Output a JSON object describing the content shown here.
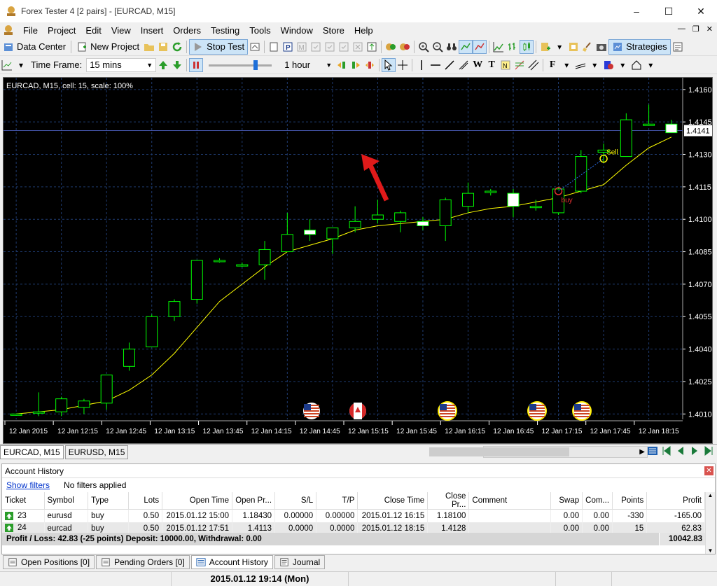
{
  "window": {
    "title": "Forex Tester 4  [2 pairs] - [EURCAD, M15]",
    "controls": [
      "–",
      "☐",
      "✕"
    ]
  },
  "menu": {
    "items": [
      "File",
      "Project",
      "Edit",
      "View",
      "Insert",
      "Orders",
      "Testing",
      "Tools",
      "Window",
      "Store",
      "Help"
    ]
  },
  "toolbar1": {
    "data_center": "Data Center",
    "new_project": "New Project",
    "stop_test": "Stop Test",
    "strategies": "Strategies"
  },
  "toolbar2": {
    "time_frame_label": "Time Frame:",
    "time_frame_value": "15 mins",
    "speed_value": "1 hour"
  },
  "chart": {
    "header": "EURCAD, M15, cell: 15, scale: 100%",
    "current_price": "1.4141",
    "colors": {
      "background": "#000000",
      "up": "#00ff00",
      "down_fill": "#ffffff",
      "ma": "#ffff00",
      "grid": "#1e3a6e"
    },
    "trade_labels": {
      "buy": "buy",
      "sell": "Sell"
    },
    "flags": [
      "us-flag",
      "us-flag",
      "canada-flag",
      "us-flag",
      "us-flag",
      "us-flag"
    ]
  },
  "chart_data": {
    "type": "candlestick",
    "y_ticks": [
      "1.4160",
      "1.4145",
      "1.4130",
      "1.4115",
      "1.4100",
      "1.4085",
      "1.4070",
      "1.4055",
      "1.4040",
      "1.4025",
      "1.4010"
    ],
    "x_ticks": [
      "12 Jan 2015",
      "12 Jan 12:15",
      "12 Jan 12:45",
      "12 Jan 13:15",
      "12 Jan 13:45",
      "12 Jan 14:15",
      "12 Jan 14:45",
      "12 Jan 15:15",
      "12 Jan 15:45",
      "12 Jan 16:15",
      "12 Jan 16:45",
      "12 Jan 17:15",
      "12 Jan 17:45",
      "12 Jan 18:15"
    ],
    "ylim": [
      1.4005,
      1.4165
    ],
    "candles": [
      {
        "o": 1.401,
        "h": 1.401,
        "l": 1.401,
        "c": 1.401
      },
      {
        "o": 1.4011,
        "h": 1.402,
        "l": 1.4009,
        "c": 1.4011
      },
      {
        "o": 1.4011,
        "h": 1.4018,
        "l": 1.4009,
        "c": 1.4017
      },
      {
        "o": 1.4013,
        "h": 1.4017,
        "l": 1.401,
        "c": 1.4016
      },
      {
        "o": 1.4015,
        "h": 1.4025,
        "l": 1.4012,
        "c": 1.4028
      },
      {
        "o": 1.4032,
        "h": 1.4043,
        "l": 1.403,
        "c": 1.404
      },
      {
        "o": 1.4041,
        "h": 1.4056,
        "l": 1.4041,
        "c": 1.4055
      },
      {
        "o": 1.4055,
        "h": 1.4063,
        "l": 1.4053,
        "c": 1.4062
      },
      {
        "o": 1.4063,
        "h": 1.4081,
        "l": 1.4061,
        "c": 1.4081
      },
      {
        "o": 1.4081,
        "h": 1.4082,
        "l": 1.408,
        "c": 1.4081
      },
      {
        "o": 1.4079,
        "h": 1.408,
        "l": 1.4078,
        "c": 1.4079
      },
      {
        "o": 1.4079,
        "h": 1.409,
        "l": 1.4072,
        "c": 1.4086
      },
      {
        "o": 1.4085,
        "h": 1.4103,
        "l": 1.4085,
        "c": 1.4093
      },
      {
        "o": 1.4095,
        "h": 1.41,
        "l": 1.409,
        "c": 1.4093
      },
      {
        "o": 1.4091,
        "h": 1.4096,
        "l": 1.4084,
        "c": 1.4096
      },
      {
        "o": 1.4096,
        "h": 1.4106,
        "l": 1.4094,
        "c": 1.4099
      },
      {
        "o": 1.41,
        "h": 1.4109,
        "l": 1.4098,
        "c": 1.4102
      },
      {
        "o": 1.4099,
        "h": 1.4104,
        "l": 1.4094,
        "c": 1.4103
      },
      {
        "o": 1.4099,
        "h": 1.4101,
        "l": 1.4095,
        "c": 1.4097
      },
      {
        "o": 1.4097,
        "h": 1.411,
        "l": 1.409,
        "c": 1.4109
      },
      {
        "o": 1.4106,
        "h": 1.4117,
        "l": 1.4103,
        "c": 1.4112
      },
      {
        "o": 1.4113,
        "h": 1.4114,
        "l": 1.4111,
        "c": 1.4113
      },
      {
        "o": 1.4112,
        "h": 1.4114,
        "l": 1.4101,
        "c": 1.4106
      },
      {
        "o": 1.4106,
        "h": 1.4109,
        "l": 1.4104,
        "c": 1.4106
      },
      {
        "o": 1.4103,
        "h": 1.4115,
        "l": 1.4102,
        "c": 1.4114
      },
      {
        "o": 1.4113,
        "h": 1.4132,
        "l": 1.4112,
        "c": 1.4129
      },
      {
        "o": 1.4131,
        "h": 1.4135,
        "l": 1.4126,
        "c": 1.4132
      },
      {
        "o": 1.4129,
        "h": 1.4149,
        "l": 1.4129,
        "c": 1.4146
      },
      {
        "o": 1.4144,
        "h": 1.4153,
        "l": 1.4144,
        "c": 1.4144
      },
      {
        "o": 1.4144,
        "h": 1.4146,
        "l": 1.4142,
        "c": 1.414
      }
    ],
    "ma": [
      1.401,
      1.4011,
      1.4012,
      1.4014,
      1.4016,
      1.4021,
      1.4028,
      1.4038,
      1.405,
      1.4062,
      1.407,
      1.4078,
      1.4085,
      1.4088,
      1.4091,
      1.4095,
      1.4097,
      1.4098,
      1.4099,
      1.41,
      1.4103,
      1.4105,
      1.4106,
      1.4108,
      1.411,
      1.4113,
      1.4116,
      1.4125,
      1.4133,
      1.4138
    ]
  },
  "chart_tabs": [
    "EURCAD, M15",
    "EURUSD, M15"
  ],
  "account_history": {
    "title": "Account History",
    "show_filters": "Show filters",
    "filters_status": "No filters applied",
    "columns": [
      "Ticket",
      "Symbol",
      "Type",
      "Lots",
      "Open Time",
      "Open Pr...",
      "S/L",
      "T/P",
      "Close Time",
      "Close Pr...",
      "Comment",
      "Swap",
      "Com...",
      "Points",
      "Profit"
    ],
    "rows": [
      [
        "23",
        "eurusd",
        "buy",
        "0.50",
        "2015.01.12 15:00",
        "1.18430",
        "0.00000",
        "0.00000",
        "2015.01.12 16:15",
        "1.18100",
        "",
        "0.00",
        "0.00",
        "-330",
        "-165.00"
      ],
      [
        "24",
        "eurcad",
        "buy",
        "0.50",
        "2015.01.12 17:51",
        "1.4113",
        "0.0000",
        "0.0000",
        "2015.01.12 18:15",
        "1.4128",
        "",
        "0.00",
        "0.00",
        "15",
        "62.83"
      ]
    ],
    "summary": "Profit / Loss: 42.83 (-25 points) Deposit: 10000.00, Withdrawal: 0.00",
    "balance": "10042.83"
  },
  "bottom_tabs": [
    "Open Positions [0]",
    "Pending Orders [0]",
    "Account History",
    "Journal"
  ],
  "status": {
    "datetime": "2015.01.12 19:14 (Mon)"
  }
}
